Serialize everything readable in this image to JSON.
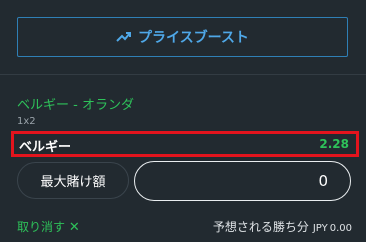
{
  "boost": {
    "label": "プライスブースト",
    "icon": "trending-up-icon"
  },
  "event": {
    "title": "ベルギー - オランダ",
    "market": "1x2"
  },
  "selection": {
    "name": "ベルギー",
    "odds": "2.28"
  },
  "stake": {
    "max_label": "最大賭け額",
    "value": "0"
  },
  "footer": {
    "cancel_label": "取り消す",
    "cancel_icon": "close-icon",
    "winnings_label": "予想される勝ち分",
    "currency": "JPY",
    "amount": "0.00"
  },
  "colors": {
    "background": "#222a30",
    "accent_green": "#2ec25a",
    "boost_blue": "#4fa8e8",
    "highlight_red": "#e3141d"
  }
}
